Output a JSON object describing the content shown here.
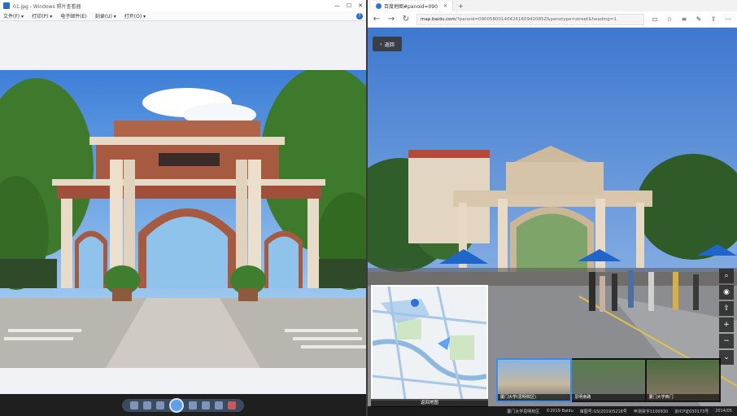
{
  "left_window": {
    "title": "01.jpg - Windows 照片查看器",
    "window_buttons": [
      "—",
      "☐",
      "✕"
    ],
    "menu": [
      "文件(F) ▾",
      "打印(P) ▾",
      "电子邮件(E)",
      "刻录(U) ▾",
      "打开(O) ▾"
    ],
    "help_label": "?"
  },
  "right_window": {
    "tab_title": "百度地图#panoid=090",
    "tab_close": "✕",
    "new_tab": "+",
    "url_domain": "map.baidu.com",
    "url_rest": "/?panoid=09005800140426160942085Z&panotype=street&heading=1",
    "back_label": "返回",
    "map_label": "返回地图",
    "thumbnails": [
      "厦门大学(思明校区)",
      "思明南路",
      "厦门大学西门"
    ],
    "footer": [
      "厦门大学思明校区",
      "©2019 Baidu",
      "审图号:GS(2019)5218号",
      "甲测资字1100930",
      "京ICP证030173号",
      "2014/05"
    ]
  },
  "colors": {
    "edge_blue": "#3070e0",
    "viewer_accent": "#2a6ad0"
  }
}
